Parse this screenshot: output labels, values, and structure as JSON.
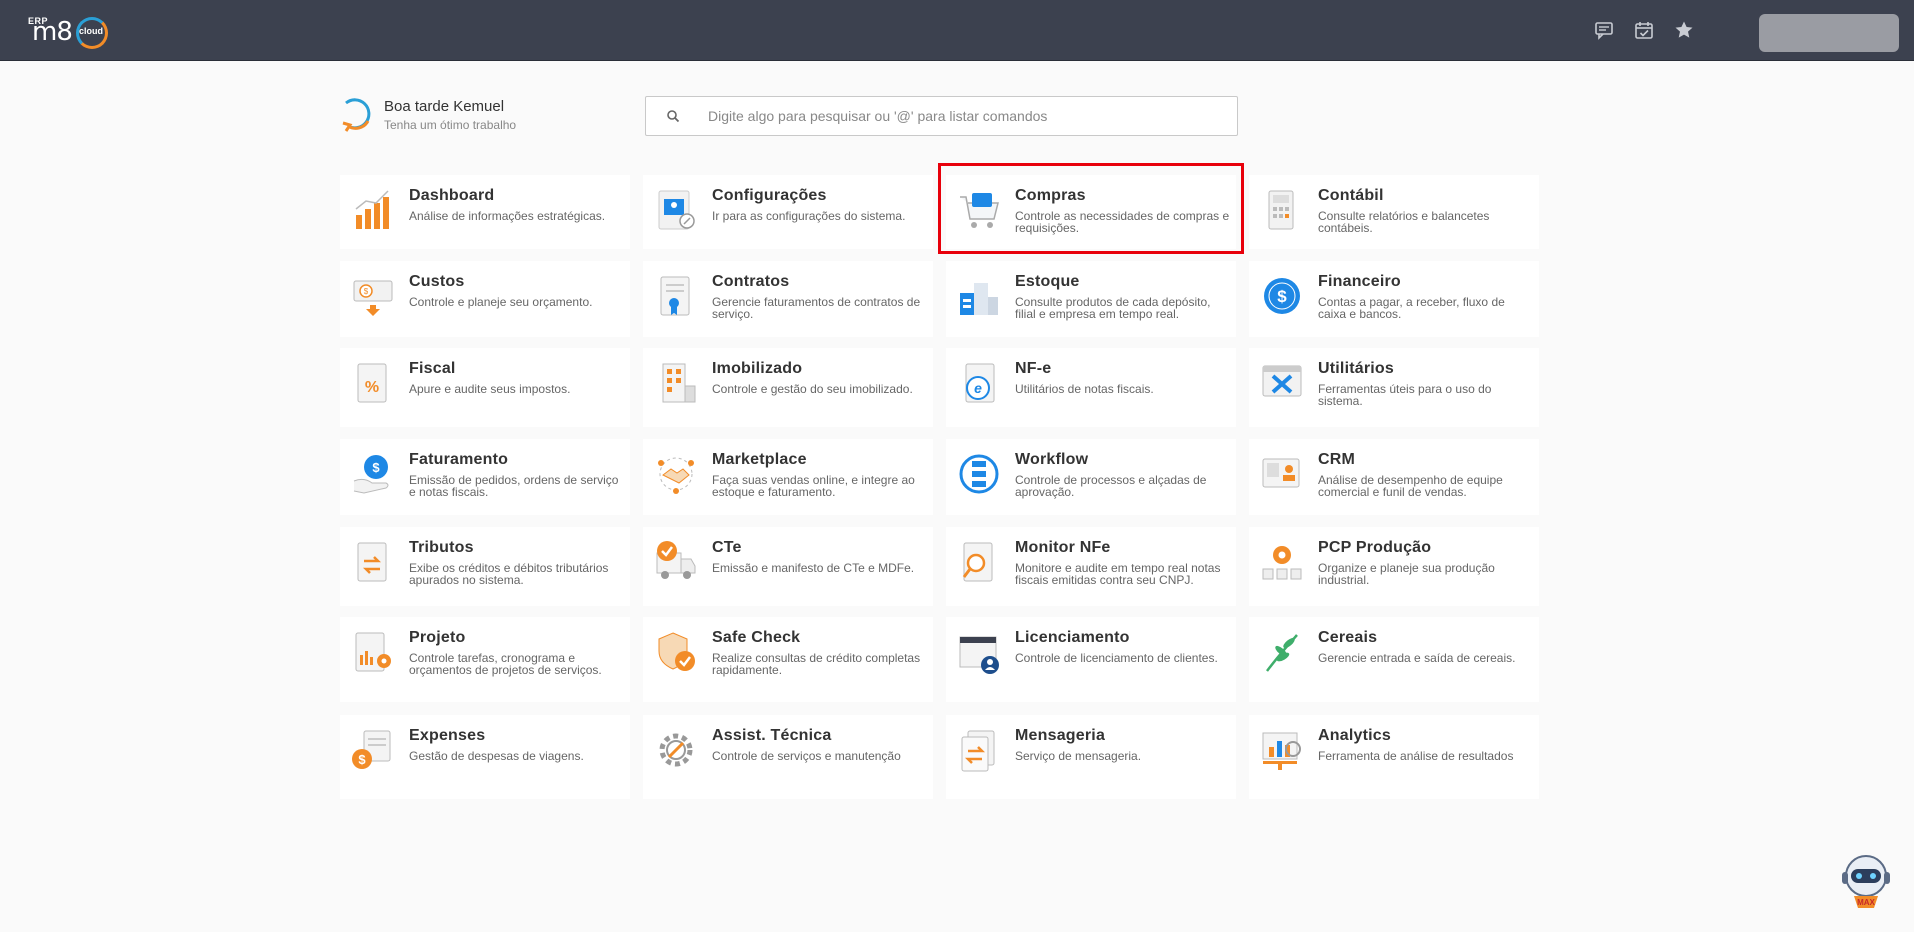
{
  "topbar": {
    "logo_erp": "ERP",
    "logo_m8": "m8",
    "logo_cloud": "cloud",
    "icons": [
      "chat-icon",
      "calendar-icon",
      "star-icon"
    ]
  },
  "greeting": {
    "title": "Boa tarde Kemuel",
    "subtitle": "Tenha um ótimo trabalho"
  },
  "search": {
    "placeholder": "Digite algo para pesquisar ou '@' para listar comandos"
  },
  "modules": [
    {
      "name": "Dashboard",
      "desc": "Análise de informações estratégicas.",
      "icon": "chart-icon"
    },
    {
      "name": "Configurações",
      "desc": "Ir para as configurações do sistema.",
      "icon": "settings-icon"
    },
    {
      "name": "Compras",
      "desc": "Controle as necessidades de compras e requisições.",
      "icon": "cart-icon"
    },
    {
      "name": "Contábil",
      "desc": "Consulte relatórios e balancetes contábeis.",
      "icon": "calculator-icon"
    },
    {
      "name": "Custos",
      "desc": "Controle e planeje seu orçamento.",
      "icon": "money-icon"
    },
    {
      "name": "Contratos",
      "desc": "Gerencie faturamentos de contratos de serviço.",
      "icon": "contract-icon"
    },
    {
      "name": "Estoque",
      "desc": "Consulte produtos de cada depósito, filial e empresa em tempo real.",
      "icon": "warehouse-icon"
    },
    {
      "name": "Financeiro",
      "desc": "Contas a pagar, a receber, fluxo de caixa e bancos.",
      "icon": "dollar-icon"
    },
    {
      "name": "Fiscal",
      "desc": "Apure e audite seus impostos.",
      "icon": "percent-icon"
    },
    {
      "name": "Imobilizado",
      "desc": "Controle e gestão do seu imobilizado.",
      "icon": "building-icon"
    },
    {
      "name": "NF-e",
      "desc": "Utilitários de notas fiscais.",
      "icon": "nfe-icon"
    },
    {
      "name": "Utilitários",
      "desc": "Ferramentas úteis para o uso do sistema.",
      "icon": "tools-icon"
    },
    {
      "name": "Faturamento",
      "desc": "Emissão de pedidos, ordens de serviço e notas fiscais.",
      "icon": "billing-icon"
    },
    {
      "name": "Marketplace",
      "desc": "Faça suas vendas online, e integre ao estoque e faturamento.",
      "icon": "handshake-icon"
    },
    {
      "name": "Workflow",
      "desc": "Controle de processos e alçadas de aprovação.",
      "icon": "workflow-icon"
    },
    {
      "name": "CRM",
      "desc": "Análise de desempenho de equipe comercial e funil de vendas.",
      "icon": "crm-icon"
    },
    {
      "name": "Tributos",
      "desc": "Exibe os créditos e débitos tributários apurados no sistema.",
      "icon": "tax-icon"
    },
    {
      "name": "CTe",
      "desc": "Emissão e manifesto de CTe e MDFe.",
      "icon": "truck-icon"
    },
    {
      "name": "Monitor NFe",
      "desc": "Monitore e audite em tempo real notas fiscais emitidas contra seu CNPJ.",
      "icon": "magnifier-icon"
    },
    {
      "name": "PCP Produção",
      "desc": "Organize e planeje sua produção industrial.",
      "icon": "production-icon"
    },
    {
      "name": "Projeto",
      "desc": "Controle tarefas, cronograma e orçamentos de projetos de serviços.",
      "icon": "project-icon"
    },
    {
      "name": "Safe Check",
      "desc": "Realize consultas de crédito completas rapidamente.",
      "icon": "shield-check-icon"
    },
    {
      "name": "Licenciamento",
      "desc": "Controle de licenciamento de clientes.",
      "icon": "license-icon"
    },
    {
      "name": "Cereais",
      "desc": "Gerencie entrada e saída de cereais.",
      "icon": "leaf-icon"
    },
    {
      "name": "Expenses",
      "desc": "Gestão de despesas de viagens.",
      "icon": "expenses-icon"
    },
    {
      "name": "Assist. Técnica",
      "desc": "Controle de serviços e manutenção",
      "icon": "gear-icon"
    },
    {
      "name": "Mensageria",
      "desc": "Serviço de mensageria.",
      "icon": "messaging-icon"
    },
    {
      "name": "Analytics",
      "desc": "Ferramenta de análise de resultados",
      "icon": "analytics-icon"
    }
  ],
  "highlighted_module": "Compras",
  "assistant": {
    "label": "MAX"
  },
  "colors": {
    "topbar": "#3c414f",
    "accent_orange": "#f28c28",
    "accent_blue": "#1e88e5",
    "highlight_red": "#e8000b"
  }
}
